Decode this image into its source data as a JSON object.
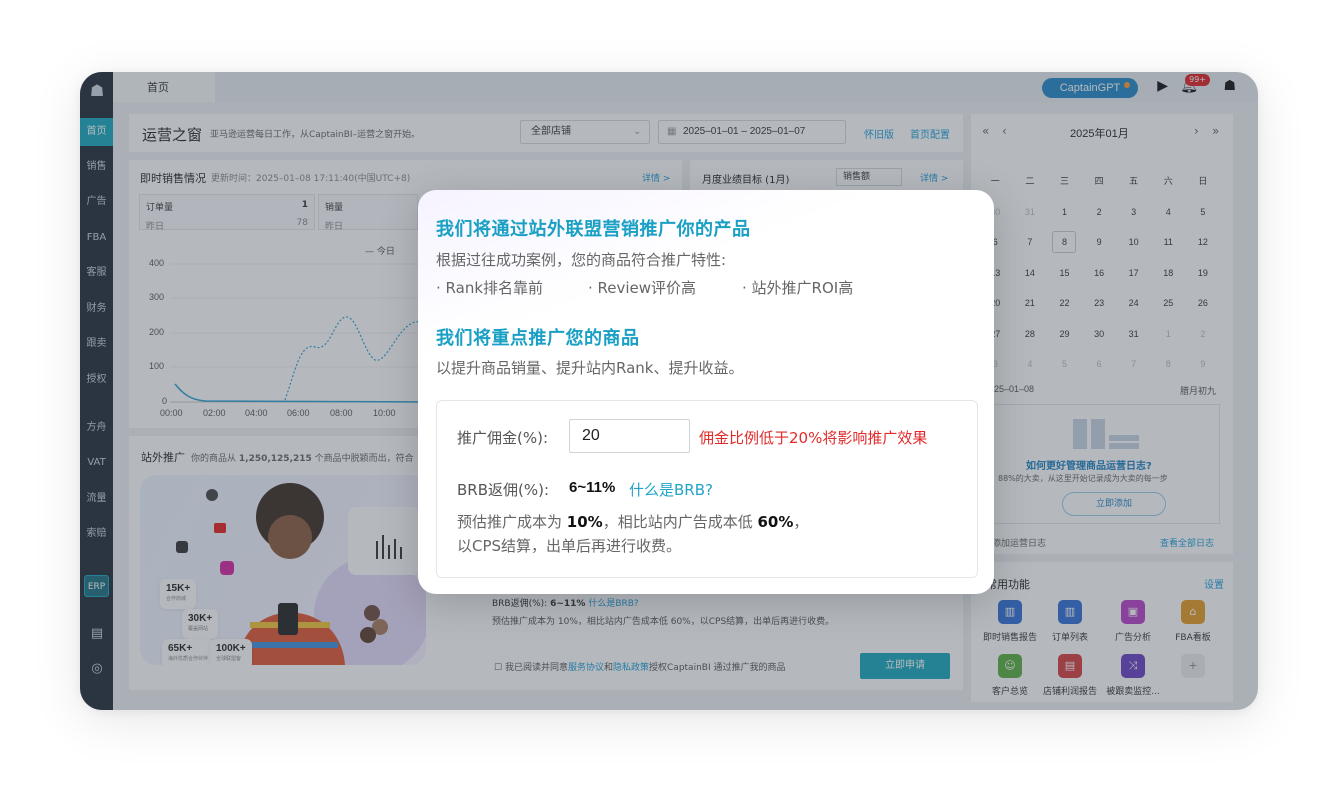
{
  "sidebar": {
    "items": [
      "首页",
      "销售",
      "广告",
      "FBA",
      "客服",
      "财务",
      "跟卖",
      "授权",
      "方舟",
      "VAT",
      "流量",
      "索赔",
      "ERP"
    ]
  },
  "topbar": {
    "tab_home": "首页",
    "gpt_label": "CaptainGPT",
    "bell_badge": "99+"
  },
  "ops": {
    "title": "运营之窗",
    "desc": "亚马逊运营每日工作，从CaptainBI–运营之窗开始。",
    "store_select": "全部店铺",
    "date_start": "2025–01–01",
    "date_sep": "–",
    "date_end": "2025–01–07",
    "old_version": "怀旧版",
    "home_config": "首页配置"
  },
  "sales": {
    "title": "即时销售情况",
    "updated": "更新时间：2025–01–08 17:11:40(中国UTC+8)",
    "detail": "详情 >",
    "stats": [
      {
        "label": "订单量",
        "value": "1",
        "sub": "昨日",
        "sub_value": "78"
      },
      {
        "label": "销量",
        "sub": "昨日"
      }
    ],
    "legend_today": "— 今日",
    "y_ticks": [
      "400",
      "300",
      "200",
      "100",
      "0"
    ],
    "x_ticks": [
      "00:00",
      "02:00",
      "04:00",
      "06:00",
      "08:00",
      "10:00"
    ]
  },
  "goal": {
    "title": "月度业绩目标 (1月)",
    "select": "销售额",
    "detail": "详情 >"
  },
  "promo": {
    "title": "站外推广",
    "desc_prefix": "你的商品从",
    "desc_count": "1,250,125,215",
    "desc_suffix": "个商品中脱颖而出，符合",
    "chips": [
      {
        "num": "15K+",
        "sub": "合作商城"
      },
      {
        "num": "30K+",
        "sub": "覆盖网站"
      },
      {
        "num": "65K+",
        "sub": "海外优质合作伙伴"
      },
      {
        "num": "100K+",
        "sub": "全球联盟客"
      }
    ],
    "brb_line_label": "BRB返佣(%):",
    "brb_line_value": "6~11%",
    "brb_line_link": "什么是BRB?",
    "cost_line": "预估推广成本为 10%，相比站内广告成本低 60%，以CPS结算，出单后再进行收费。",
    "agree_prefix": "我已阅读并同意",
    "agree_service": "服务协议",
    "agree_and": "和",
    "agree_privacy": "隐私政策",
    "agree_suffix": "授权CaptainBI 通过推广我的商品",
    "apply_button": "立即申请"
  },
  "calendar": {
    "title": "2025年01月",
    "weekdays": [
      "一",
      "二",
      "三",
      "四",
      "五",
      "六",
      "日"
    ],
    "weeks": [
      [
        "30",
        "31",
        "1",
        "2",
        "3",
        "4",
        "5"
      ],
      [
        "6",
        "7",
        "8",
        "9",
        "10",
        "11",
        "12"
      ],
      [
        "13",
        "14",
        "15",
        "16",
        "17",
        "18",
        "19"
      ],
      [
        "20",
        "21",
        "22",
        "23",
        "24",
        "25",
        "26"
      ],
      [
        "27",
        "28",
        "29",
        "30",
        "31",
        "1",
        "2"
      ],
      [
        "3",
        "4",
        "5",
        "6",
        "7",
        "8",
        "9"
      ]
    ],
    "selected_date": "2025–01–08",
    "lunar": "腊月初九",
    "log_question": "如何更好管理商品运营日志?",
    "log_sub": "88%的大卖，从这里开始记录成为大卖的每一步",
    "log_add": "立即添加",
    "log_add_footer": "添加运营日志",
    "log_view_all": "查看全部日志"
  },
  "common": {
    "title": "常用功能",
    "settings": "设置",
    "items": [
      "即时销售报告",
      "订单列表",
      "广告分析",
      "FBA看板",
      "客户总览",
      "店铺利润报告",
      "被跟卖监控..."
    ]
  },
  "modal": {
    "heading1": "我们将通过站外联盟营销推广你的产品",
    "para1": "根据过往成功案例，您的商品符合推广特性:",
    "bullets": [
      "· Rank排名靠前",
      "· Review评价高",
      "· 站外推广ROI高"
    ],
    "heading2": "我们将重点推广您的商品",
    "para2": "以提升商品销量、提升站内Rank、提升收益。",
    "commission_label": "推广佣金(%):",
    "commission_value": "20",
    "commission_warning": "佣金比例低于20%将影响推广效果",
    "brb_label": "BRB返佣(%):",
    "brb_value": "6~11%",
    "brb_link": "什么是BRB?",
    "est_line1_prefix": "预估推广成本为 ",
    "est_line1_pct": "10%",
    "est_line1_mid": "，相比站内广告成本低 ",
    "est_line1_pct2": "60%",
    "est_line1_suffix": "，",
    "est_line2": "以CPS结算，出单后再进行收费。"
  }
}
